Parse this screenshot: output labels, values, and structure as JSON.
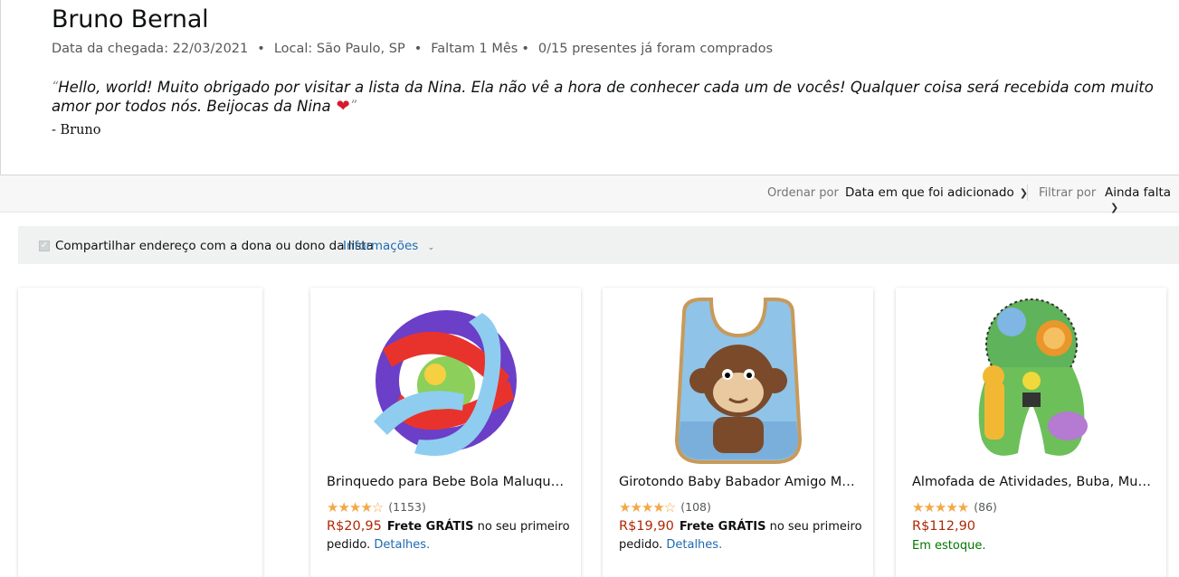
{
  "header": {
    "owner_name": "Bruno Bernal",
    "arrival": "Data da chegada: 22/03/2021",
    "location": "Local: São Paulo, SP",
    "remaining": "Faltam 1 Mês",
    "purchased": "0/15 presentes já foram comprados",
    "message": "Hello, world! Muito obrigado por visitar a lista da Nina. Ela não vê a hora de conhecer cada um de vocês! Qualquer coisa será recebida com muito amor por todos nós. Beijocas da Nina",
    "signature": "- Bruno"
  },
  "sortbar": {
    "sort_label": "Ordenar por",
    "sort_value": "Data em que foi adicionado",
    "filter_label": "Filtrar por",
    "filter_value": "Ainda falta"
  },
  "share": {
    "text": "Compartilhar endereço com a dona ou dono da lista",
    "info_link": "Informações"
  },
  "products": [
    {
      "title": "Brinquedo para Bebe Bola Maluquinha Calesita",
      "rating": 4.5,
      "stars": "★★★★☆",
      "reviews": "(1153)",
      "price": "R$20,95",
      "frete": "Frete GRÁTIS",
      "frete_rest": " no seu primeiro pedido.",
      "details": "Detalhes."
    },
    {
      "title": "Girotondo Baby Babador Amigo Macaco",
      "rating": 4,
      "stars": "★★★★☆",
      "reviews": "(108)",
      "price": "R$19,90",
      "frete": "Frete GRÁTIS",
      "frete_rest": " no seu primeiro pedido.",
      "details": "Detalhes."
    },
    {
      "title": "Almofada de Atividades, Buba, Multicolorido",
      "rating": 5,
      "stars": "★★★★★",
      "reviews": "(86)",
      "price": "R$112,90",
      "stock": "Em estoque."
    }
  ],
  "colors": {
    "price": "#b12704",
    "link": "#1e6ab0",
    "star": "#f3a847",
    "stock": "#007600"
  }
}
